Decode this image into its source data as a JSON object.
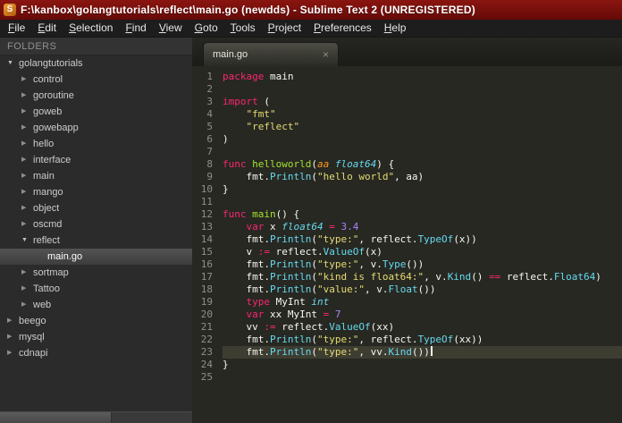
{
  "window": {
    "title": "F:\\kanbox\\golangtutorials\\reflect\\main.go (newdds) - Sublime Text 2 (UNREGISTERED)",
    "app_icon_letter": "S"
  },
  "menu": {
    "items": [
      "File",
      "Edit",
      "Selection",
      "Find",
      "View",
      "Goto",
      "Tools",
      "Project",
      "Preferences",
      "Help"
    ]
  },
  "sidebar": {
    "header": "FOLDERS",
    "items": [
      {
        "label": "golangtutorials",
        "level": 0,
        "expanded": true,
        "file": false,
        "selected": false
      },
      {
        "label": "control",
        "level": 1,
        "expanded": false,
        "file": false,
        "selected": false
      },
      {
        "label": "goroutine",
        "level": 1,
        "expanded": false,
        "file": false,
        "selected": false
      },
      {
        "label": "goweb",
        "level": 1,
        "expanded": false,
        "file": false,
        "selected": false
      },
      {
        "label": "gowebapp",
        "level": 1,
        "expanded": false,
        "file": false,
        "selected": false
      },
      {
        "label": "hello",
        "level": 1,
        "expanded": false,
        "file": false,
        "selected": false
      },
      {
        "label": "interface",
        "level": 1,
        "expanded": false,
        "file": false,
        "selected": false
      },
      {
        "label": "main",
        "level": 1,
        "expanded": false,
        "file": false,
        "selected": false
      },
      {
        "label": "mango",
        "level": 1,
        "expanded": false,
        "file": false,
        "selected": false
      },
      {
        "label": "object",
        "level": 1,
        "expanded": false,
        "file": false,
        "selected": false
      },
      {
        "label": "oscmd",
        "level": 1,
        "expanded": false,
        "file": false,
        "selected": false
      },
      {
        "label": "reflect",
        "level": 1,
        "expanded": true,
        "file": false,
        "selected": false
      },
      {
        "label": "main.go",
        "level": 2,
        "expanded": false,
        "file": true,
        "selected": true
      },
      {
        "label": "sortmap",
        "level": 1,
        "expanded": false,
        "file": false,
        "selected": false
      },
      {
        "label": "Tattoo",
        "level": 1,
        "expanded": false,
        "file": false,
        "selected": false
      },
      {
        "label": "web",
        "level": 1,
        "expanded": false,
        "file": false,
        "selected": false
      },
      {
        "label": "beego",
        "level": 0,
        "expanded": false,
        "file": false,
        "selected": false
      },
      {
        "label": "mysql",
        "level": 0,
        "expanded": false,
        "file": false,
        "selected": false
      },
      {
        "label": "cdnapi",
        "level": 0,
        "expanded": false,
        "file": false,
        "selected": false
      }
    ]
  },
  "editor": {
    "tab": {
      "label": "main.go",
      "close": "×"
    },
    "current_line": 23,
    "lines": [
      [
        [
          "k",
          "package"
        ],
        [
          "p",
          " main"
        ]
      ],
      [],
      [
        [
          "k",
          "import"
        ],
        [
          "p",
          " ("
        ]
      ],
      [
        [
          "p",
          "    "
        ],
        [
          "s",
          "\"fmt\""
        ]
      ],
      [
        [
          "p",
          "    "
        ],
        [
          "s",
          "\"reflect\""
        ]
      ],
      [
        [
          "p",
          ")"
        ]
      ],
      [],
      [
        [
          "k",
          "func"
        ],
        [
          "p",
          " "
        ],
        [
          "f",
          "helloworld"
        ],
        [
          "p",
          "("
        ],
        [
          "a",
          "aa"
        ],
        [
          "p",
          " "
        ],
        [
          "t",
          "float64"
        ],
        [
          "p",
          ") {"
        ]
      ],
      [
        [
          "p",
          "    fmt."
        ],
        [
          "c",
          "Println"
        ],
        [
          "p",
          "("
        ],
        [
          "s",
          "\"hello world\""
        ],
        [
          "p",
          ", aa)"
        ]
      ],
      [
        [
          "p",
          "}"
        ]
      ],
      [],
      [
        [
          "k",
          "func"
        ],
        [
          "p",
          " "
        ],
        [
          "f",
          "main"
        ],
        [
          "p",
          "() {"
        ]
      ],
      [
        [
          "p",
          "    "
        ],
        [
          "k",
          "var"
        ],
        [
          "p",
          " x "
        ],
        [
          "t",
          "float64"
        ],
        [
          "o",
          " = "
        ],
        [
          "n",
          "3.4"
        ]
      ],
      [
        [
          "p",
          "    fmt."
        ],
        [
          "c",
          "Println"
        ],
        [
          "p",
          "("
        ],
        [
          "s",
          "\"type:\""
        ],
        [
          "p",
          ", reflect."
        ],
        [
          "c",
          "TypeOf"
        ],
        [
          "p",
          "(x))"
        ]
      ],
      [
        [
          "p",
          "    v "
        ],
        [
          "o",
          ":="
        ],
        [
          "p",
          " reflect."
        ],
        [
          "c",
          "ValueOf"
        ],
        [
          "p",
          "(x)"
        ]
      ],
      [
        [
          "p",
          "    fmt."
        ],
        [
          "c",
          "Println"
        ],
        [
          "p",
          "("
        ],
        [
          "s",
          "\"type:\""
        ],
        [
          "p",
          ", v."
        ],
        [
          "c",
          "Type"
        ],
        [
          "p",
          "())"
        ]
      ],
      [
        [
          "p",
          "    fmt."
        ],
        [
          "c",
          "Println"
        ],
        [
          "p",
          "("
        ],
        [
          "s",
          "\"kind is float64:\""
        ],
        [
          "p",
          ", v."
        ],
        [
          "c",
          "Kind"
        ],
        [
          "p",
          "() "
        ],
        [
          "o",
          "=="
        ],
        [
          "p",
          " reflect."
        ],
        [
          "c",
          "Float64"
        ],
        [
          "p",
          ")"
        ]
      ],
      [
        [
          "p",
          "    fmt."
        ],
        [
          "c",
          "Println"
        ],
        [
          "p",
          "("
        ],
        [
          "s",
          "\"value:\""
        ],
        [
          "p",
          ", v."
        ],
        [
          "c",
          "Float"
        ],
        [
          "p",
          "())"
        ]
      ],
      [
        [
          "p",
          "    "
        ],
        [
          "k",
          "type"
        ],
        [
          "p",
          " MyInt "
        ],
        [
          "t",
          "int"
        ]
      ],
      [
        [
          "p",
          "    "
        ],
        [
          "k",
          "var"
        ],
        [
          "p",
          " xx MyInt "
        ],
        [
          "o",
          "="
        ],
        [
          "p",
          " "
        ],
        [
          "n",
          "7"
        ]
      ],
      [
        [
          "p",
          "    vv "
        ],
        [
          "o",
          ":="
        ],
        [
          "p",
          " reflect."
        ],
        [
          "c",
          "ValueOf"
        ],
        [
          "p",
          "(xx)"
        ]
      ],
      [
        [
          "p",
          "    fmt."
        ],
        [
          "c",
          "Println"
        ],
        [
          "p",
          "("
        ],
        [
          "s",
          "\"type:\""
        ],
        [
          "p",
          ", reflect."
        ],
        [
          "c",
          "TypeOf"
        ],
        [
          "p",
          "(xx))"
        ]
      ],
      [
        [
          "p",
          "    fmt."
        ],
        [
          "c",
          "Println"
        ],
        [
          "p",
          "("
        ],
        [
          "s",
          "\"type:\""
        ],
        [
          "p",
          ", vv."
        ],
        [
          "c",
          "Kind"
        ],
        [
          "p",
          "())"
        ]
      ],
      [
        [
          "p",
          "}"
        ]
      ],
      []
    ]
  },
  "colors": {
    "editor_background": "#272822",
    "titlebar_red": "#7a0f0b",
    "keyword_pink": "#f92672",
    "string_yellow": "#e6db74",
    "type_cyan": "#66d9ef",
    "function_green": "#a6e22e",
    "number_purple": "#ae81ff",
    "param_orange": "#fd971f",
    "plain_text": "#f8f8f2",
    "line_number_gray": "#8f908a",
    "current_line_highlight": "#3e3d32"
  }
}
